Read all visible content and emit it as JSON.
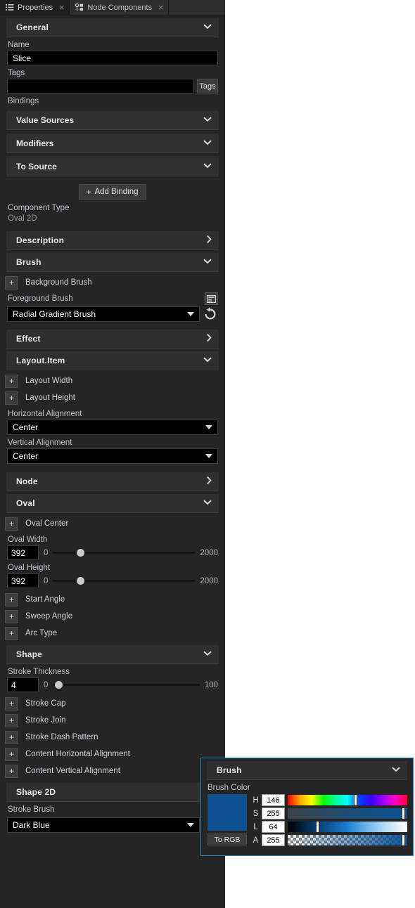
{
  "tabs": [
    {
      "label": "Properties",
      "icon": "list-icon",
      "close": "×",
      "active": true
    },
    {
      "label": "Node Components",
      "icon": "nodes-icon",
      "close": "×",
      "active": false
    }
  ],
  "general": {
    "header": "General",
    "chevron": "⌄",
    "name_label": "Name",
    "name_value": "Slice",
    "tags_label": "Tags",
    "tags_value": "",
    "tags_button": "Tags",
    "bindings_label": "Bindings",
    "binding_sections": [
      {
        "label": "Value Sources",
        "chevron": "⌄"
      },
      {
        "label": "Modifiers",
        "chevron": "⌄"
      },
      {
        "label": "To Source",
        "chevron": "⌄"
      }
    ],
    "add_binding": "Add Binding",
    "add_binding_plus": "+",
    "component_type_label": "Component Type",
    "component_type_value": "Oval 2D"
  },
  "description": {
    "header": "Description",
    "chevron": "›"
  },
  "brush": {
    "header": "Brush",
    "chevron": "⌄",
    "background_brush": "Background Brush",
    "background_plus": "+",
    "foreground_label": "Foreground Brush",
    "foreground_value": "Radial Gradient Brush",
    "picker_icon": "panel-picker-icon",
    "reset_icon": "reset-arrow-icon"
  },
  "effect": {
    "header": "Effect",
    "chevron": "›"
  },
  "layout_item": {
    "header": "Layout.Item",
    "chevron": "⌄",
    "plus_rows": [
      {
        "label": "Layout Width",
        "plus": "+"
      },
      {
        "label": "Layout Height",
        "plus": "+"
      }
    ],
    "horizontal_alignment_label": "Horizontal Alignment",
    "horizontal_alignment_value": "Center",
    "vertical_alignment_label": "Vertical Alignment",
    "vertical_alignment_value": "Center"
  },
  "node": {
    "header": "Node",
    "chevron": "›"
  },
  "oval": {
    "header": "Oval",
    "chevron": "⌄",
    "oval_center": {
      "label": "Oval Center",
      "plus": "+"
    },
    "width": {
      "label": "Oval Width",
      "value": "392",
      "min": "0",
      "max": "2000",
      "percent": 19.6
    },
    "height": {
      "label": "Oval Height",
      "value": "392",
      "min": "0",
      "max": "2000",
      "percent": 19.6
    },
    "plus_rows": [
      {
        "label": "Start Angle",
        "plus": "+"
      },
      {
        "label": "Sweep Angle",
        "plus": "+"
      },
      {
        "label": "Arc Type",
        "plus": "+"
      }
    ]
  },
  "shape": {
    "header": "Shape",
    "chevron": "⌄",
    "stroke_thickness": {
      "label": "Stroke Thickness",
      "value": "4",
      "min": "0",
      "max": "100",
      "percent": 4
    },
    "plus_rows": [
      {
        "label": "Stroke Cap",
        "plus": "+"
      },
      {
        "label": "Stroke Join",
        "plus": "+"
      },
      {
        "label": "Stroke Dash Pattern",
        "plus": "+"
      },
      {
        "label": "Content Horizontal Alignment",
        "plus": "+"
      },
      {
        "label": "Content Vertical Alignment",
        "plus": "+"
      }
    ]
  },
  "shape2d": {
    "header": "Shape 2D",
    "stroke_brush_label": "Stroke Brush",
    "stroke_brush_value": "Dark Blue",
    "picker_icon": "panel-picker-icon",
    "reset_icon": "reset-arrow-icon"
  },
  "popup": {
    "header": "Brush",
    "chevron": "⌄",
    "brush_color_label": "Brush Color",
    "swatch_color": "#0d5193",
    "to_rgb": "To RGB",
    "channels": [
      {
        "name": "H",
        "value": "146",
        "percent": 57
      },
      {
        "name": "S",
        "value": "255",
        "percent": 97
      },
      {
        "name": "L",
        "value": "64",
        "percent": 25
      },
      {
        "name": "A",
        "value": "255",
        "percent": 97
      }
    ]
  },
  "colors": {
    "panel_bg": "#252526",
    "section_bg": "#2f2f30",
    "field_bg": "#000000",
    "accent": "#1e8ad6",
    "label_text": "#bfc4cb"
  }
}
